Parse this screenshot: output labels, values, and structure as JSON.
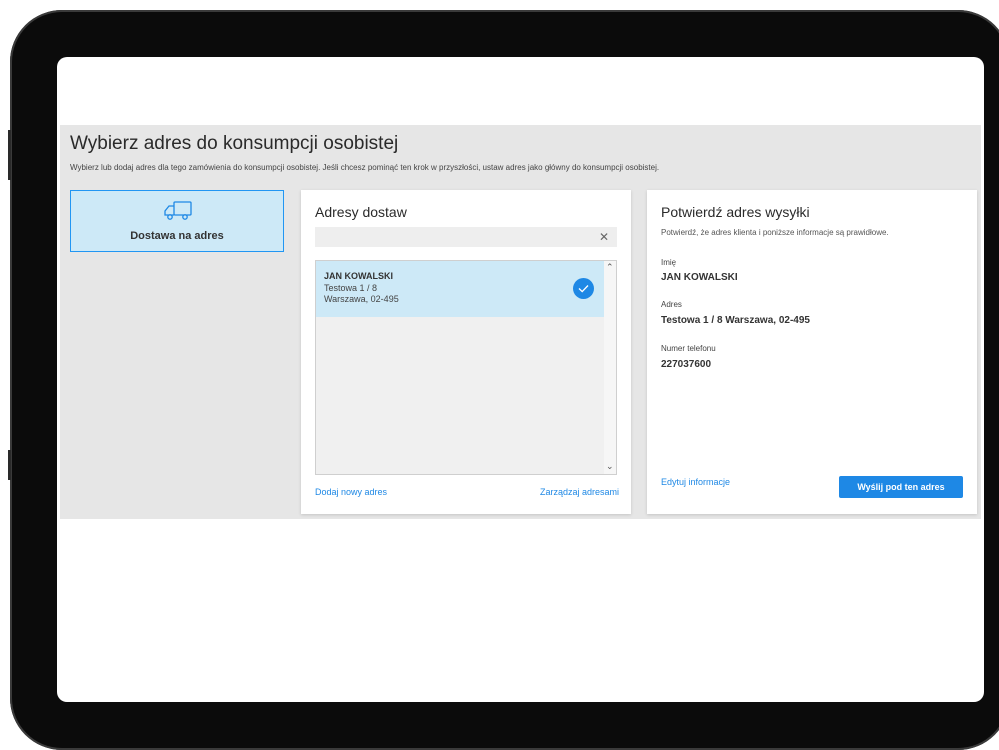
{
  "page": {
    "title": "Wybierz adres do konsumpcji osobistej",
    "subtitle": "Wybierz lub dodaj adres dla tego zamówienia do konsumpcji osobistej. Jeśli chcesz pominąć ten krok w przyszłości, ustaw adres jako główny do konsumpcji osobistej."
  },
  "delivery_method": {
    "label": "Dostawa na adres",
    "icon": "truck-icon"
  },
  "addresses": {
    "title": "Adresy dostaw",
    "search_value": "",
    "clear_icon": "close-icon",
    "items": [
      {
        "name": "JAN KOWALSKI",
        "line1": "Testowa 1 / 8",
        "line2": "Warszawa, 02-495",
        "selected": true
      }
    ],
    "add_link": "Dodaj nowy adres",
    "manage_link": "Zarządzaj adresami"
  },
  "confirm": {
    "title": "Potwierdź adres wysyłki",
    "description": "Potwierdź, że adres klienta i poniższe informacje są prawidłowe.",
    "name_label": "Imię",
    "name_value": "JAN KOWALSKI",
    "address_label": "Adres",
    "address_value": "Testowa 1 / 8 Warszawa, 02-495",
    "phone_label": "Numer telefonu",
    "phone_value": "227037600",
    "edit_link": "Edytuj informacje",
    "send_button": "Wyślij pod ten adres"
  },
  "colors": {
    "accent": "#1e88e5",
    "selected_bg": "#cde9f7",
    "panel_bg": "#e6e6e6",
    "device_frame": "#0b0b0b"
  }
}
